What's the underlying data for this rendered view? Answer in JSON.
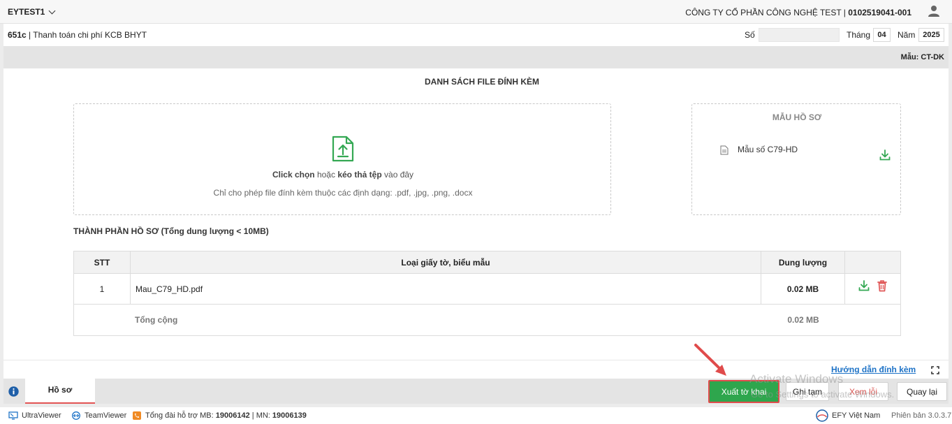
{
  "topbar": {
    "org_code": "EYTEST1",
    "company_name": "CÔNG TY CỔ PHẦN CÔNG NGHỆ TEST",
    "separator": " | ",
    "tax_code": "0102519041-001"
  },
  "form": {
    "code": "651c",
    "separator": " | ",
    "title": "Thanh toán chi phí KCB BHYT",
    "so_label": "Số",
    "so_value": "",
    "thang_label": "Tháng",
    "thang_value": "04",
    "nam_label": "Năm",
    "nam_value": "2025",
    "mau_label": "Mẫu: CT-DK"
  },
  "attachments": {
    "heading": "DANH SÁCH FILE ĐÍNH KÈM",
    "dropzone": {
      "click_text": "Click chọn",
      "or_text": " hoặc ",
      "drag_text": "kéo thả tệp",
      "here_text": " vào đây",
      "formats_text": "Chỉ cho phép file đính kèm thuộc các định dạng: .pdf, .jpg, .png, .docx"
    },
    "templates": {
      "heading": "MẪU HỒ SƠ",
      "items": [
        {
          "name": "Mẫu số C79-HD"
        }
      ]
    }
  },
  "components": {
    "heading": "THÀNH PHẦN HỒ SƠ (Tổng dung lượng < 10MB)",
    "columns": [
      "STT",
      "Loại giấy tờ, biểu mẫu",
      "Dung lượng",
      ""
    ],
    "rows": [
      {
        "stt": "1",
        "name": "Mau_C79_HD.pdf",
        "size": "0.02 MB"
      }
    ],
    "total_label": "Tổng cộng",
    "total_size": "0.02 MB"
  },
  "footer_links": {
    "guide": "Hướng dẫn đính kèm"
  },
  "tabs": {
    "hoso": "Hồ sơ"
  },
  "actions": {
    "submit": "Xuất tờ khai",
    "draft": "Ghi tạm",
    "errors": "Xem lỗi",
    "back": "Quay lại"
  },
  "watermark": {
    "line1": "Activate Windows",
    "line2": "Go to Settings to activate Windows."
  },
  "statusbar": {
    "ultraviewer": "UltraViewer",
    "teamviewer": "TeamViewer",
    "support_prefix": "Tổng đài hỗ trợ MB: ",
    "support_mb": "19006142",
    "support_mid": " | MN: ",
    "support_mn": "19006139",
    "vendor": "EFY Việt Nam",
    "version": "Phiên bản 3.0.3.7"
  },
  "colors": {
    "primary_green": "#2ea64d",
    "danger_red": "#d9534f",
    "link_blue": "#1e73c7",
    "annotation_red": "#e04b4b"
  }
}
